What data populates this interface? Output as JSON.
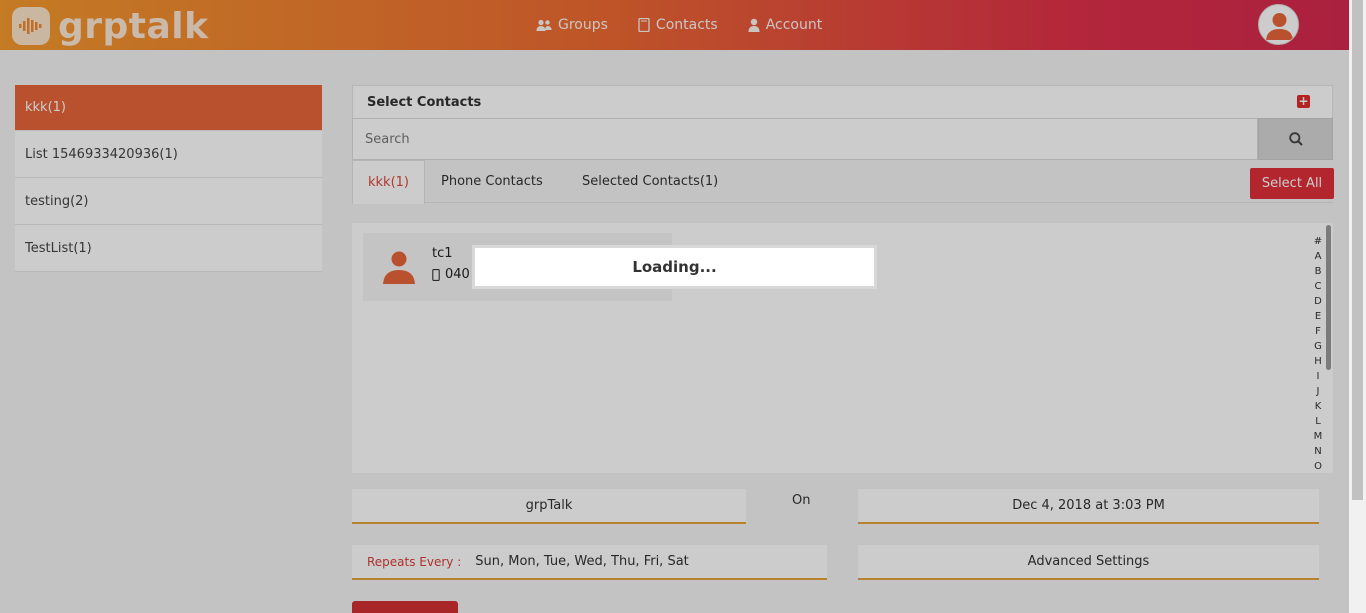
{
  "header": {
    "logo_text": "grptalk",
    "nav": [
      {
        "label": "Groups",
        "icon": "users-icon"
      },
      {
        "label": "Contacts",
        "icon": "address-book-icon"
      },
      {
        "label": "Account",
        "icon": "user-icon"
      }
    ]
  },
  "sidebar": {
    "items": [
      {
        "label": "kkk(1)",
        "active": true
      },
      {
        "label": "List 1546933420936(1)",
        "active": false
      },
      {
        "label": "testing(2)",
        "active": false
      },
      {
        "label": "TestList(1)",
        "active": false
      }
    ]
  },
  "panel": {
    "title": "Select Contacts",
    "add_icon": "plus-square-icon"
  },
  "search": {
    "placeholder": "Search",
    "icon": "search-icon"
  },
  "tabs": [
    {
      "label": "kkk(1)",
      "active": true
    },
    {
      "label": "Phone Contacts",
      "active": false
    },
    {
      "label": "Selected Contacts(1)",
      "active": false
    }
  ],
  "select_all_label": "Select All",
  "contacts": [
    {
      "name": "tc1",
      "phone": "040",
      "phone_icon": "mobile-icon"
    }
  ],
  "alphabet": [
    "#",
    "A",
    "B",
    "C",
    "D",
    "E",
    "F",
    "G",
    "H",
    "I",
    "J",
    "K",
    "L",
    "M",
    "N",
    "O"
  ],
  "schedule": {
    "group_name": "grpTalk",
    "on_label": "On",
    "datetime": "Dec 4, 2018 at 3:03 PM",
    "repeats_label": "Repeats Every :",
    "repeats_value": "Sun, Mon, Tue, Wed, Thu, Fri, Sat",
    "advanced_label": "Advanced Settings"
  },
  "loading_text": "Loading...",
  "colors": {
    "accent": "#e8663a",
    "danger": "#e0303a",
    "underline": "#e6a23a"
  }
}
